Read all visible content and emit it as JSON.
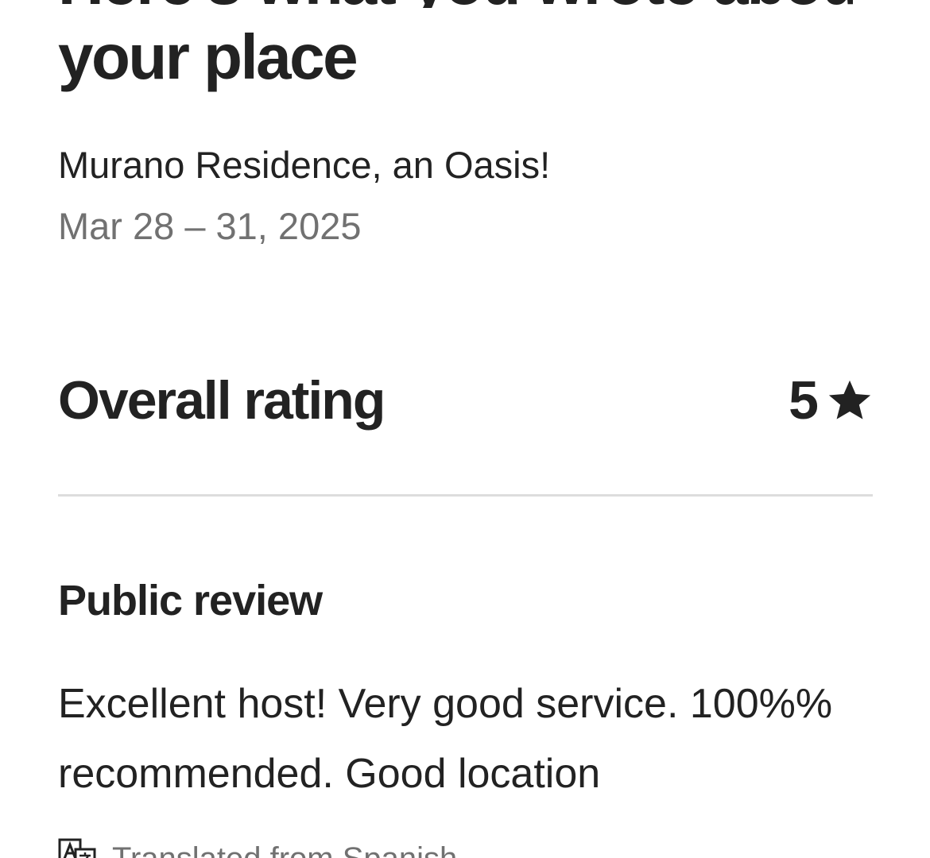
{
  "page": {
    "title_line_1": "Here's what you wrote about",
    "title_line_2": "your place"
  },
  "listing": {
    "name": "Murano Residence, an Oasis!",
    "dates": "Mar 28 – 31, 2025"
  },
  "rating": {
    "label": "Overall rating",
    "value": "5",
    "icon": "star-icon"
  },
  "public_review": {
    "title": "Public review",
    "text": "Excellent host! Very good service. 100%% recommended. Good location"
  },
  "translation": {
    "icon": "translate-icon",
    "text": "Translated from Spanish"
  },
  "colors": {
    "primary_text": "#222222",
    "secondary_text": "#717171",
    "divider": "#dddddd",
    "background": "#ffffff"
  }
}
